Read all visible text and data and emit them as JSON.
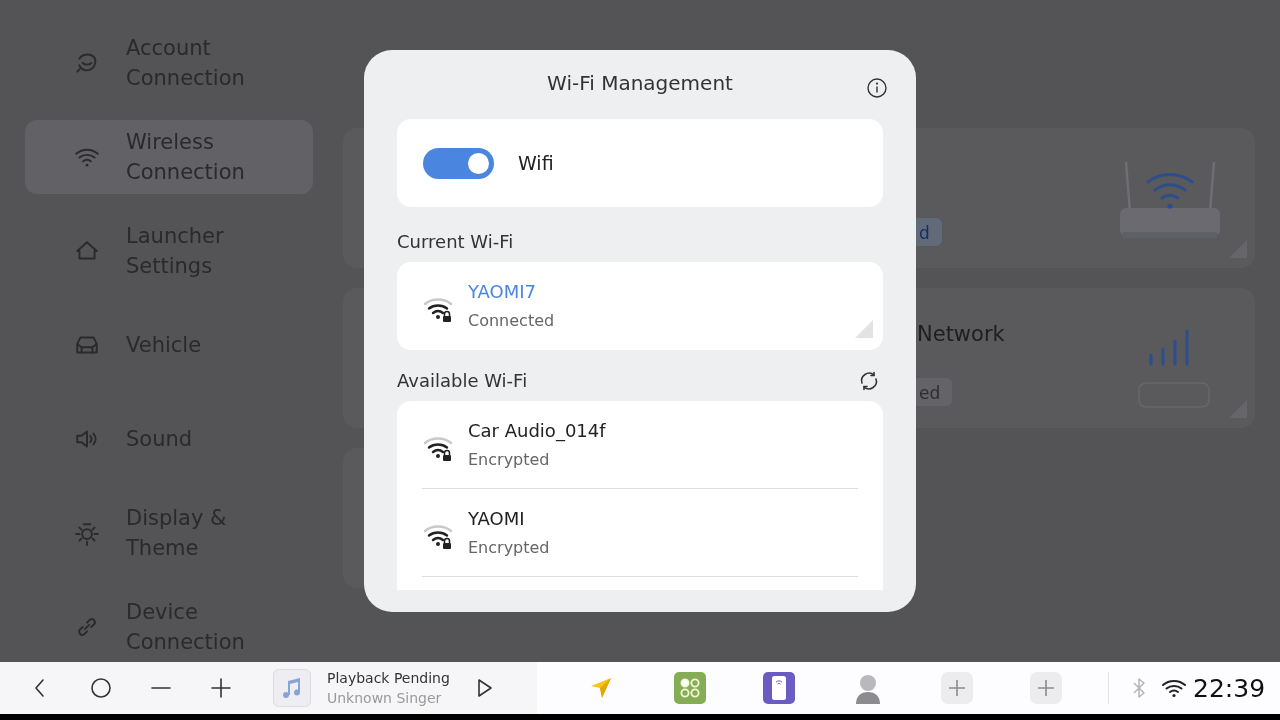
{
  "sidebar": {
    "items": [
      {
        "label": "Account Connection",
        "selected": false
      },
      {
        "label": "Wireless Connection",
        "selected": true
      },
      {
        "label": "Launcher Settings",
        "selected": false
      },
      {
        "label": "Vehicle",
        "selected": false
      },
      {
        "label": "Sound",
        "selected": false
      },
      {
        "label": "Display & Theme",
        "selected": false
      },
      {
        "label": "Device Connection",
        "selected": false
      }
    ]
  },
  "main": {
    "cards": [
      {
        "kind": "router",
        "button": {
          "label": "d",
          "active": true
        }
      },
      {
        "kind": "cellular",
        "title": "Network",
        "button": {
          "label": "ed",
          "active": false
        }
      },
      {
        "kind": "blank"
      }
    ]
  },
  "dialog": {
    "title": "Wi-Fi Management",
    "wifi_toggle": {
      "label": "Wifi",
      "on": true
    },
    "current": {
      "heading": "Current Wi-Fi",
      "networks": [
        {
          "name": "YAOMI7",
          "status": "Connected",
          "connected": true
        }
      ]
    },
    "available": {
      "heading": "Available Wi-Fi",
      "networks": [
        {
          "name": "Car Audio_014f",
          "status": "Encrypted",
          "connected": false
        },
        {
          "name": "YAOMI",
          "status": "Encrypted",
          "connected": false
        }
      ]
    }
  },
  "taskbar": {
    "media": {
      "title": "Playback Pending",
      "artist": "Unknown Singer"
    },
    "clock": "22:39"
  }
}
